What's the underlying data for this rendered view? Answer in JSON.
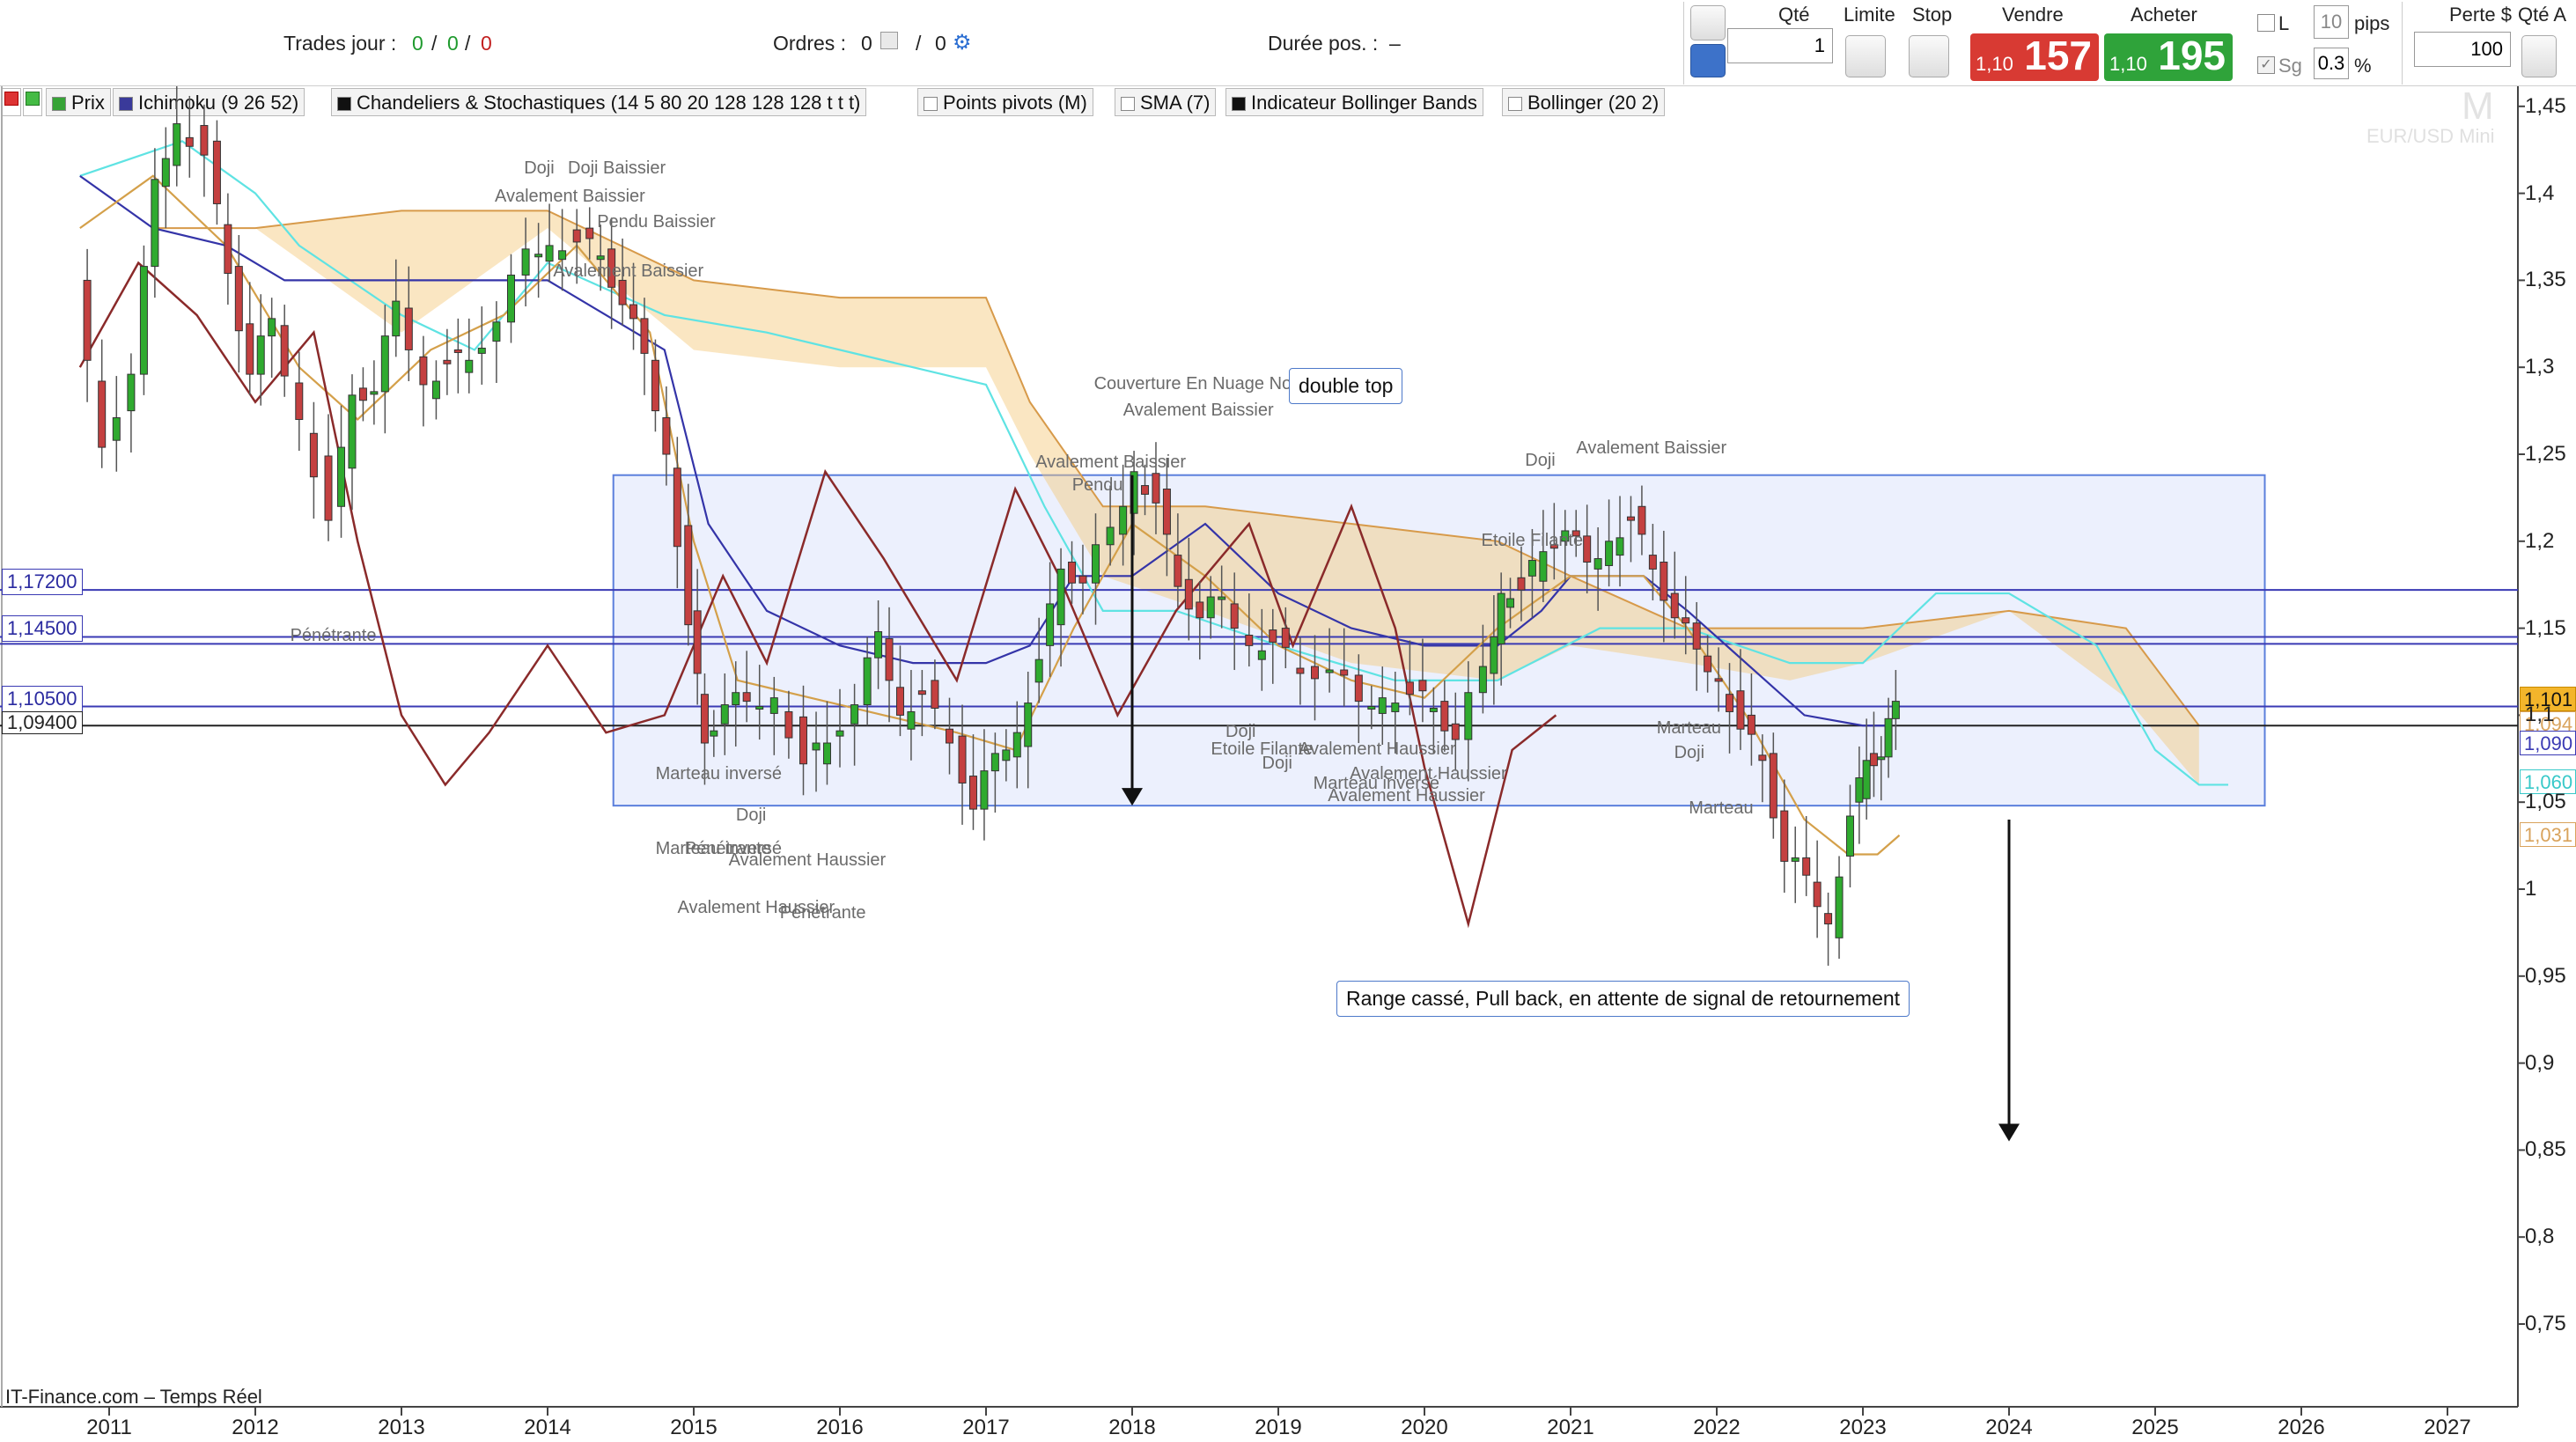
{
  "header": {
    "trades_label": "Trades jour :",
    "trades_a": "0",
    "trades_sep1": "/",
    "trades_b": "0",
    "trades_sep2": "/",
    "trades_c": "0",
    "orders_label": "Ordres :",
    "orders_a": "0",
    "orders_sep": "/",
    "orders_b": "0",
    "duration_label": "Durée pos. :",
    "duration_value": "–"
  },
  "order_panel": {
    "qty_label": "Qté",
    "qty_value": "1",
    "limit_label": "Limite",
    "stop_label": "Stop",
    "sell_label": "Vendre",
    "sell_prefix": "1,10",
    "sell_big": "157",
    "buy_label": "Acheter",
    "buy_prefix": "1,10",
    "buy_big": "195",
    "l_label": "L",
    "pips_value": "10",
    "pips_label": "pips",
    "sg_label": "Sg",
    "pct_value": "0.3",
    "pct_label": "%",
    "loss_label": "Perte $",
    "loss_value": "100",
    "qty_auto_label": "Qté A",
    "sell_color": "#d83a33",
    "buy_color": "#2fa33a"
  },
  "indicators": [
    {
      "label": "Prix",
      "swatch": "#36a336"
    },
    {
      "label": "Ichimoku (9 26 52)",
      "swatch": "#3a3a9a"
    },
    {
      "label": "Chandeliers & Stochastiques (14 5 80 20 128 128 128 t t t)",
      "swatch": "#111111"
    },
    {
      "label": "Points pivots (M)",
      "swatch": "#ffffff"
    },
    {
      "label": "SMA (7)",
      "swatch": "#ffffff"
    },
    {
      "label": "Indicateur Bollinger Bands",
      "swatch": "#111111"
    },
    {
      "label": "Bollinger (20 2)",
      "swatch": "#ffffff"
    }
  ],
  "watermark": {
    "letter": "M",
    "name": "EUR/USD Mini"
  },
  "footer": {
    "source": "IT-Finance.com – Temps Réel"
  },
  "level_labels": [
    "1,17200",
    "1,14500",
    "1,10500",
    "1,09400"
  ],
  "right_tags": [
    {
      "text": "1,101",
      "bg": "#f3b52b",
      "border": "#c88a00",
      "value": 1.101
    },
    {
      "text": "1,094",
      "bg": "#ffffff",
      "border": "#d9a35c",
      "value": 1.094
    },
    {
      "text": "1,090",
      "bg": "#ffffff",
      "border": "#3a3ab4",
      "value": 1.09
    },
    {
      "text": "1,060",
      "bg": "#ffffff",
      "border": "#38c9c9",
      "value": 1.06
    },
    {
      "text": "1,031",
      "bg": "#ffffff",
      "border": "#d9a35c",
      "value": 1.031
    }
  ],
  "annotations": {
    "double_top": "double top",
    "range": "Range cassé, Pull back, en attente de signal de retournement"
  },
  "patterns": [
    {
      "text": "Avalement Baissier",
      "x": 2014.4,
      "y": 1.355
    },
    {
      "text": "Doji",
      "x": 2014.2,
      "y": 1.414
    },
    {
      "text": "Doji Baissier",
      "x": 2014.5,
      "y": 1.414
    },
    {
      "text": "Avalement Baissier",
      "x": 2014.0,
      "y": 1.398
    },
    {
      "text": "Pendu Baissier",
      "x": 2014.7,
      "y": 1.383
    },
    {
      "text": "Pénétrante",
      "x": 2012.6,
      "y": 1.145
    },
    {
      "text": "Couverture En Nuage Noir",
      "x": 2018.1,
      "y": 1.29
    },
    {
      "text": "Avalement Baissier",
      "x": 2018.3,
      "y": 1.275
    },
    {
      "text": "Avalement Baissier",
      "x": 2017.7,
      "y": 1.245
    },
    {
      "text": "Pendu",
      "x": 2017.95,
      "y": 1.232
    },
    {
      "text": "Doji",
      "x": 2021.05,
      "y": 1.246
    },
    {
      "text": "Avalement Baissier",
      "x": 2021.4,
      "y": 1.253
    },
    {
      "text": "Etoile Filante",
      "x": 2020.75,
      "y": 1.2
    },
    {
      "text": "Marteau inversé",
      "x": 2015.1,
      "y": 1.066
    },
    {
      "text": "Doji",
      "x": 2015.65,
      "y": 1.042
    },
    {
      "text": "Marteau inversé",
      "x": 2015.1,
      "y": 1.023
    },
    {
      "text": "Pénétrante",
      "x": 2015.3,
      "y": 1.023
    },
    {
      "text": "Avalement Haussier",
      "x": 2015.6,
      "y": 1.016
    },
    {
      "text": "Avalement Haussier",
      "x": 2015.25,
      "y": 0.989
    },
    {
      "text": "Pénétrante",
      "x": 2015.95,
      "y": 0.986
    },
    {
      "text": "Etoile Filante",
      "x": 2018.9,
      "y": 1.08
    },
    {
      "text": "Doji",
      "x": 2019.0,
      "y": 1.09
    },
    {
      "text": "Doji",
      "x": 2019.25,
      "y": 1.072
    },
    {
      "text": "Avalement Haussier",
      "x": 2019.5,
      "y": 1.08
    },
    {
      "text": "Avalement Haussier",
      "x": 2019.85,
      "y": 1.066
    },
    {
      "text": "Marteau inversé",
      "x": 2019.6,
      "y": 1.06
    },
    {
      "text": "Avalement Haussier",
      "x": 2019.7,
      "y": 1.053
    },
    {
      "text": "Marteau",
      "x": 2021.95,
      "y": 1.092
    },
    {
      "text": "Doji",
      "x": 2022.07,
      "y": 1.078
    },
    {
      "text": "Marteau",
      "x": 2022.17,
      "y": 1.046
    }
  ],
  "chart_data": {
    "type": "candlestick",
    "title": "EUR/USD Mini",
    "timeframe": "monthly",
    "xlabel": "",
    "ylabel": "",
    "xlim": [
      2010.8,
      2027.5
    ],
    "ylim": [
      0.715,
      1.455
    ],
    "x_ticks": [
      "2011",
      "2012",
      "2013",
      "2014",
      "2015",
      "2016",
      "2017",
      "2018",
      "2019",
      "2020",
      "2021",
      "2022",
      "2023",
      "2024",
      "2025",
      "2026",
      "2027"
    ],
    "y_ticks": [
      "1,45",
      "1,4",
      "1,35",
      "1,3",
      "1,25",
      "1,2",
      "1,15",
      "1,1",
      "1,05",
      "1",
      "0,95",
      "0,9",
      "0,85",
      "0,8",
      "0,75"
    ],
    "grid": false,
    "horizontal_levels": [
      1.172,
      1.145,
      1.105,
      1.094
    ],
    "range_box": {
      "x": [
        2014.45,
        2025.75
      ],
      "y": [
        1.048,
        1.238
      ]
    },
    "target_arrows": [
      {
        "x": 2018.0,
        "from": 1.238,
        "to": 1.048
      },
      {
        "x": 2024.0,
        "from": 1.04,
        "to": 0.855
      }
    ],
    "price": [
      [
        2010.8,
        1.35
      ],
      [
        2011.0,
        1.25
      ],
      [
        2011.2,
        1.3
      ],
      [
        2011.35,
        1.4
      ],
      [
        2011.5,
        1.44
      ],
      [
        2011.7,
        1.43
      ],
      [
        2011.85,
        1.35
      ],
      [
        2012.0,
        1.3
      ],
      [
        2012.15,
        1.32
      ],
      [
        2012.35,
        1.27
      ],
      [
        2012.55,
        1.22
      ],
      [
        2012.7,
        1.28
      ],
      [
        2012.85,
        1.29
      ],
      [
        2013.0,
        1.33
      ],
      [
        2013.2,
        1.29
      ],
      [
        2013.35,
        1.31
      ],
      [
        2013.5,
        1.3
      ],
      [
        2013.7,
        1.33
      ],
      [
        2013.9,
        1.36
      ],
      [
        2014.05,
        1.37
      ],
      [
        2014.25,
        1.38
      ],
      [
        2014.4,
        1.36
      ],
      [
        2014.55,
        1.34
      ],
      [
        2014.7,
        1.3
      ],
      [
        2014.85,
        1.25
      ],
      [
        2015.0,
        1.16
      ],
      [
        2015.1,
        1.08
      ],
      [
        2015.25,
        1.11
      ],
      [
        2015.4,
        1.1
      ],
      [
        2015.6,
        1.11
      ],
      [
        2015.8,
        1.08
      ],
      [
        2015.95,
        1.08
      ],
      [
        2016.15,
        1.11
      ],
      [
        2016.3,
        1.14
      ],
      [
        2016.45,
        1.1
      ],
      [
        2016.6,
        1.12
      ],
      [
        2016.8,
        1.08
      ],
      [
        2016.95,
        1.05
      ],
      [
        2017.1,
        1.07
      ],
      [
        2017.25,
        1.09
      ],
      [
        2017.4,
        1.14
      ],
      [
        2017.55,
        1.18
      ],
      [
        2017.7,
        1.18
      ],
      [
        2017.9,
        1.2
      ],
      [
        2018.05,
        1.24
      ],
      [
        2018.2,
        1.23
      ],
      [
        2018.35,
        1.17
      ],
      [
        2018.5,
        1.16
      ],
      [
        2018.65,
        1.16
      ],
      [
        2018.85,
        1.14
      ],
      [
        2019.0,
        1.15
      ],
      [
        2019.2,
        1.12
      ],
      [
        2019.4,
        1.13
      ],
      [
        2019.6,
        1.1
      ],
      [
        2019.75,
        1.11
      ],
      [
        2019.95,
        1.12
      ],
      [
        2020.1,
        1.1
      ],
      [
        2020.25,
        1.09
      ],
      [
        2020.45,
        1.12
      ],
      [
        2020.55,
        1.17
      ],
      [
        2020.7,
        1.18
      ],
      [
        2020.85,
        1.19
      ],
      [
        2021.0,
        1.21
      ],
      [
        2021.15,
        1.18
      ],
      [
        2021.3,
        1.2
      ],
      [
        2021.45,
        1.22
      ],
      [
        2021.6,
        1.18
      ],
      [
        2021.75,
        1.16
      ],
      [
        2021.9,
        1.13
      ],
      [
        2022.05,
        1.12
      ],
      [
        2022.2,
        1.1
      ],
      [
        2022.35,
        1.07
      ],
      [
        2022.5,
        1.02
      ],
      [
        2022.65,
        1.0
      ],
      [
        2022.8,
        0.98
      ],
      [
        2022.95,
        1.05
      ],
      [
        2023.05,
        1.07
      ],
      [
        2023.15,
        1.08
      ],
      [
        2023.25,
        1.1
      ]
    ],
    "series": [
      {
        "name": "Kumo",
        "color": "#f5d393",
        "upper": [
          [
            2011.3,
            1.38
          ],
          [
            2012.0,
            1.38
          ],
          [
            2013.0,
            1.39
          ],
          [
            2014.0,
            1.39
          ],
          [
            2015.0,
            1.35
          ],
          [
            2016.0,
            1.34
          ],
          [
            2017.0,
            1.34
          ],
          [
            2017.3,
            1.28
          ],
          [
            2017.8,
            1.22
          ],
          [
            2018.5,
            1.22
          ],
          [
            2019.5,
            1.21
          ],
          [
            2020.5,
            1.2
          ],
          [
            2021.0,
            1.18
          ],
          [
            2021.8,
            1.15
          ],
          [
            2022.5,
            1.15
          ],
          [
            2023.0,
            1.15
          ],
          [
            2024.0,
            1.16
          ],
          [
            2024.8,
            1.15
          ],
          [
            2025.3,
            1.094
          ]
        ],
        "lower": [
          [
            2011.3,
            1.38
          ],
          [
            2012.0,
            1.38
          ],
          [
            2013.0,
            1.32
          ],
          [
            2014.0,
            1.38
          ],
          [
            2015.0,
            1.31
          ],
          [
            2016.0,
            1.3
          ],
          [
            2017.0,
            1.3
          ],
          [
            2017.3,
            1.25
          ],
          [
            2017.8,
            1.18
          ],
          [
            2018.5,
            1.16
          ],
          [
            2019.5,
            1.13
          ],
          [
            2020.5,
            1.12
          ],
          [
            2021.0,
            1.14
          ],
          [
            2021.8,
            1.13
          ],
          [
            2022.5,
            1.12
          ],
          [
            2023.0,
            1.13
          ],
          [
            2024.0,
            1.16
          ],
          [
            2024.8,
            1.11
          ],
          [
            2025.3,
            1.06
          ]
        ]
      },
      {
        "name": "Senkou B",
        "color": "#5fe3e3",
        "points": [
          [
            2010.8,
            1.41
          ],
          [
            2011.5,
            1.43
          ],
          [
            2012.0,
            1.4
          ],
          [
            2012.3,
            1.37
          ],
          [
            2013.0,
            1.33
          ],
          [
            2013.5,
            1.31
          ],
          [
            2014.0,
            1.36
          ],
          [
            2014.8,
            1.33
          ],
          [
            2015.5,
            1.32
          ],
          [
            2016.5,
            1.3
          ],
          [
            2017.0,
            1.29
          ],
          [
            2017.4,
            1.22
          ],
          [
            2017.8,
            1.16
          ],
          [
            2018.3,
            1.16
          ],
          [
            2019.0,
            1.14
          ],
          [
            2019.8,
            1.12
          ],
          [
            2020.5,
            1.12
          ],
          [
            2021.2,
            1.15
          ],
          [
            2021.8,
            1.15
          ],
          [
            2022.5,
            1.13
          ],
          [
            2023.0,
            1.13
          ],
          [
            2023.5,
            1.17
          ],
          [
            2024.0,
            1.17
          ],
          [
            2024.6,
            1.14
          ],
          [
            2025.0,
            1.08
          ],
          [
            2025.3,
            1.06
          ],
          [
            2025.5,
            1.06
          ]
        ]
      },
      {
        "name": "Kijun",
        "color": "#3434a8",
        "points": [
          [
            2010.8,
            1.41
          ],
          [
            2011.3,
            1.38
          ],
          [
            2011.8,
            1.37
          ],
          [
            2012.2,
            1.35
          ],
          [
            2012.8,
            1.35
          ],
          [
            2013.5,
            1.35
          ],
          [
            2014.0,
            1.35
          ],
          [
            2014.8,
            1.31
          ],
          [
            2015.1,
            1.21
          ],
          [
            2015.5,
            1.16
          ],
          [
            2016.0,
            1.14
          ],
          [
            2016.5,
            1.13
          ],
          [
            2017.0,
            1.13
          ],
          [
            2017.3,
            1.14
          ],
          [
            2017.6,
            1.18
          ],
          [
            2018.0,
            1.18
          ],
          [
            2018.5,
            1.21
          ],
          [
            2019.0,
            1.17
          ],
          [
            2019.5,
            1.15
          ],
          [
            2020.0,
            1.14
          ],
          [
            2020.5,
            1.14
          ],
          [
            2020.8,
            1.16
          ],
          [
            2021.0,
            1.18
          ],
          [
            2021.5,
            1.18
          ],
          [
            2021.8,
            1.16
          ],
          [
            2022.2,
            1.13
          ],
          [
            2022.6,
            1.1
          ],
          [
            2023.0,
            1.094
          ],
          [
            2023.2,
            1.094
          ]
        ]
      },
      {
        "name": "Tenkan",
        "color": "#d4a04a",
        "points": [
          [
            2010.8,
            1.38
          ],
          [
            2011.3,
            1.41
          ],
          [
            2011.8,
            1.37
          ],
          [
            2012.3,
            1.3
          ],
          [
            2012.7,
            1.27
          ],
          [
            2013.2,
            1.31
          ],
          [
            2013.7,
            1.33
          ],
          [
            2014.2,
            1.37
          ],
          [
            2014.7,
            1.32
          ],
          [
            2015.0,
            1.2
          ],
          [
            2015.3,
            1.12
          ],
          [
            2015.8,
            1.11
          ],
          [
            2016.3,
            1.1
          ],
          [
            2016.8,
            1.09
          ],
          [
            2017.2,
            1.08
          ],
          [
            2017.6,
            1.15
          ],
          [
            2018.0,
            1.21
          ],
          [
            2018.5,
            1.18
          ],
          [
            2019.0,
            1.14
          ],
          [
            2019.5,
            1.12
          ],
          [
            2020.0,
            1.11
          ],
          [
            2020.5,
            1.15
          ],
          [
            2021.0,
            1.18
          ],
          [
            2021.5,
            1.18
          ],
          [
            2021.8,
            1.15
          ],
          [
            2022.2,
            1.1
          ],
          [
            2022.6,
            1.04
          ],
          [
            2022.9,
            1.02
          ],
          [
            2023.1,
            1.02
          ],
          [
            2023.25,
            1.031
          ]
        ]
      },
      {
        "name": "Chikou",
        "color": "#8a2a2a",
        "points": [
          [
            2010.8,
            1.3
          ],
          [
            2011.2,
            1.36
          ],
          [
            2011.6,
            1.33
          ],
          [
            2012.0,
            1.28
          ],
          [
            2012.4,
            1.32
          ],
          [
            2012.7,
            1.2
          ],
          [
            2013.0,
            1.1
          ],
          [
            2013.3,
            1.06
          ],
          [
            2013.6,
            1.09
          ],
          [
            2014.0,
            1.14
          ],
          [
            2014.4,
            1.09
          ],
          [
            2014.8,
            1.1
          ],
          [
            2015.2,
            1.18
          ],
          [
            2015.5,
            1.13
          ],
          [
            2015.9,
            1.24
          ],
          [
            2016.3,
            1.19
          ],
          [
            2016.8,
            1.12
          ],
          [
            2017.2,
            1.23
          ],
          [
            2017.5,
            1.18
          ],
          [
            2017.9,
            1.1
          ],
          [
            2018.3,
            1.16
          ],
          [
            2018.8,
            1.21
          ],
          [
            2019.1,
            1.14
          ],
          [
            2019.5,
            1.22
          ],
          [
            2019.8,
            1.15
          ],
          [
            2020.0,
            1.07
          ],
          [
            2020.3,
            0.98
          ],
          [
            2020.6,
            1.08
          ],
          [
            2020.9,
            1.1
          ]
        ]
      }
    ]
  }
}
